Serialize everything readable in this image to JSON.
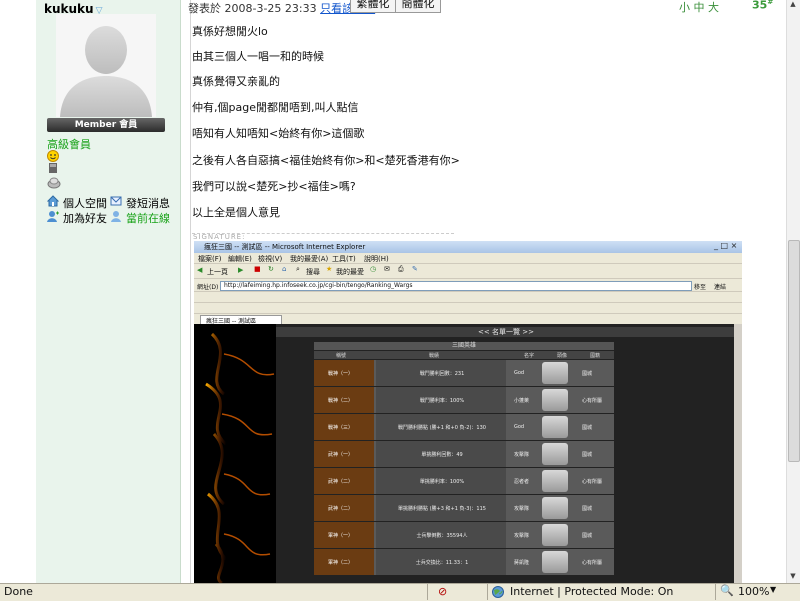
{
  "user": {
    "name": "kukuku",
    "member_label": "Member 會員",
    "rank": "高級會員",
    "actions": [
      "個人空間",
      "發短消息",
      "加為好友",
      "當前在線"
    ]
  },
  "post": {
    "posted_at": "發表於 2008-3-25 23:33",
    "author_only": "只看該作者",
    "tabs": [
      "繁體化",
      "簡體化"
    ],
    "font_sizes": "小 中 大",
    "floor": "35",
    "lines": [
      "真係好想閒火lo",
      "由其三個人一唱一和的時候",
      "真係覺得又亲亂的",
      "仲有,個page閒都閒唔到,叫人點信",
      "唔知有人知唔知<始終有你>這個歌",
      "之後有人各自惡搞<福佳始終有你>和<楚死香港有你>",
      "我們可以說<楚死>抄<福佳>嗎?",
      "以上全是個人意見"
    ],
    "signature_label": "SIGNATURE:"
  },
  "embedded": {
    "window_title": "瘋狂三國 -- 測試區 -- Microsoft Internet Explorer",
    "menu": [
      "檔案(F)",
      "編輯(E)",
      "檢視(V)",
      "我的最愛(A)",
      "工具(T)",
      "說明(H)"
    ],
    "toolbar_labels": [
      "上一頁",
      "搜尋",
      "我的最愛"
    ],
    "address_label": "網址(D)",
    "address_url": "http://lafeiming.hp.infoseek.co.jp/cgi-bin/tengo/Ranking_Wargs",
    "go_label": "移至",
    "link_label": "連結",
    "tab_label": "瘋狂三國 -- 測試區",
    "header": "<< 名單一覽 >>",
    "subheader": "三國英雄",
    "columns": [
      "稱號",
      "戰績",
      "名字",
      "頭像",
      "國籍"
    ],
    "rows": [
      {
        "title": "戰神（一）",
        "record": "戰鬥勝利回數：231",
        "name": "God",
        "nation": "國城"
      },
      {
        "title": "戰神（二）",
        "record": "戰鬥勝利率：100%",
        "name": "小蓬萊",
        "nation": "心有所屬"
      },
      {
        "title": "戰神（三）",
        "record": "戰鬥勝利勝點 (勝+1 和+0 負-2)：130",
        "name": "God",
        "nation": "國城"
      },
      {
        "title": "武神（一）",
        "record": "單挑勝利回數：49",
        "name": "攻擊隊",
        "nation": "國城"
      },
      {
        "title": "武神（二）",
        "record": "單挑勝利率：100%",
        "name": "忍者者",
        "nation": "心有所屬"
      },
      {
        "title": "武神（二）",
        "record": "單挑勝利勝點 (勝+3 和+1 負-3)：115",
        "name": "攻擊隊",
        "nation": "國城"
      },
      {
        "title": "軍神（一）",
        "record": "士兵撃倒數：35594人",
        "name": "攻擊隊",
        "nation": "國城"
      },
      {
        "title": "軍神（二）",
        "record": "士兵交換比：11.33：1",
        "name": "蔣凱隆",
        "nation": "心有所屬"
      }
    ]
  },
  "status": {
    "left": "Done",
    "zone": "Internet | Protected Mode: On",
    "zoom": "100%"
  }
}
